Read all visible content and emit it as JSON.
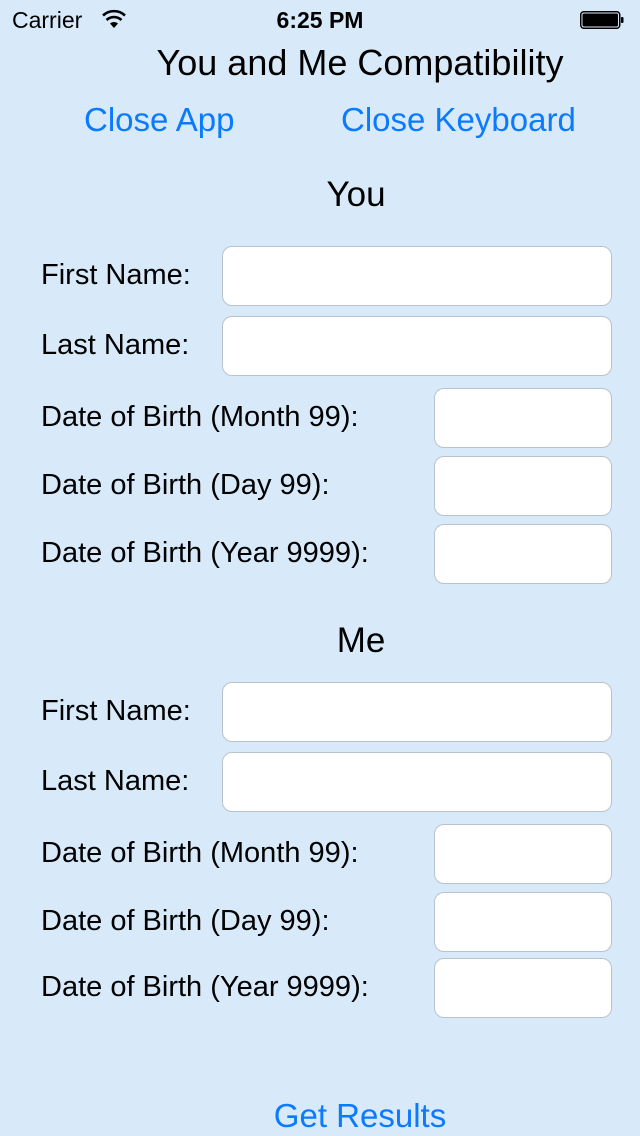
{
  "status_bar": {
    "carrier": "Carrier",
    "time": "6:25 PM",
    "wifi_icon": "wifi-icon",
    "battery_icon": "battery-icon"
  },
  "header": {
    "title": "You and Me Compatibility",
    "close_app_label": "Close App",
    "close_keyboard_label": "Close Keyboard"
  },
  "you": {
    "heading": "You",
    "first_name_label": "First Name:",
    "first_name_value": "",
    "last_name_label": "Last Name:",
    "last_name_value": "",
    "month_label": "Date of Birth (Month 99):",
    "month_value": "",
    "day_label": "Date of Birth (Day 99):",
    "day_value": "",
    "year_label": "Date of Birth (Year 9999):",
    "year_value": ""
  },
  "me": {
    "heading": "Me",
    "first_name_label": "First Name:",
    "first_name_value": "",
    "last_name_label": "Last Name:",
    "last_name_value": "",
    "month_label": "Date of Birth (Month 99):",
    "month_value": "",
    "day_label": "Date of Birth (Day 99):",
    "day_value": "",
    "year_label": "Date of Birth (Year 9999):",
    "year_value": ""
  },
  "footer": {
    "get_results_label": "Get Results"
  },
  "colors": {
    "background": "#d8eafa",
    "accent": "#0a7aff"
  }
}
